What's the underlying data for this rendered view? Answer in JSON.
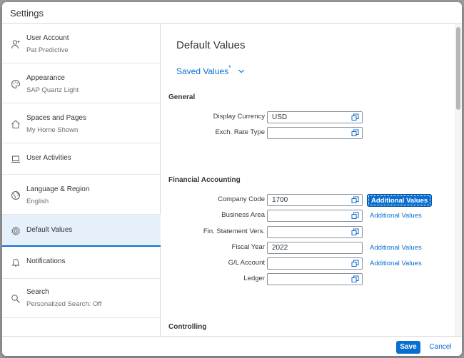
{
  "dialog": {
    "title": "Settings"
  },
  "sidebar": {
    "items": [
      {
        "label": "User Account",
        "sublabel": "Pat Predictive",
        "icon": "user-icon"
      },
      {
        "label": "Appearance",
        "sublabel": "SAP Quartz Light",
        "icon": "palette-icon"
      },
      {
        "label": "Spaces and Pages",
        "sublabel": "My Home Shown",
        "icon": "home-icon"
      },
      {
        "label": "User Activities",
        "sublabel": "",
        "icon": "laptop-icon"
      },
      {
        "label": "Language & Region",
        "sublabel": "English",
        "icon": "globe-icon"
      },
      {
        "label": "Default Values",
        "sublabel": "",
        "icon": "gear-icon",
        "selected": true
      },
      {
        "label": "Notifications",
        "sublabel": "",
        "icon": "bell-icon"
      },
      {
        "label": "Search",
        "sublabel": "Personalized Search: Off",
        "icon": "search-icon"
      }
    ]
  },
  "main": {
    "title": "Default Values",
    "variant": {
      "label": "Saved Values",
      "modified_marker": "*"
    },
    "sections": {
      "general": {
        "title": "General",
        "fields": [
          {
            "label": "Display Currency",
            "value": "USD"
          },
          {
            "label": "Exch. Rate Type",
            "value": ""
          }
        ]
      },
      "financial": {
        "title": "Financial Accounting",
        "fields": [
          {
            "label": "Company Code",
            "value": "1700",
            "additional": "Additional Values"
          },
          {
            "label": "Business Area",
            "value": "",
            "additional": "Additional Values"
          },
          {
            "label": "Fin. Statement Vers.",
            "value": ""
          },
          {
            "label": "Fiscal Year",
            "value": "2022",
            "additional": "Additional Values"
          },
          {
            "label": "G/L Account",
            "value": "",
            "additional": "Additional Values"
          },
          {
            "label": "Ledger",
            "value": ""
          }
        ]
      },
      "controlling": {
        "title": "Controlling"
      }
    }
  },
  "footer": {
    "save_label": "Save",
    "cancel_label": "Cancel"
  },
  "colors": {
    "accent": "#0a6ed1",
    "selected_bg": "#e5f0fa",
    "text": "#32363a"
  }
}
